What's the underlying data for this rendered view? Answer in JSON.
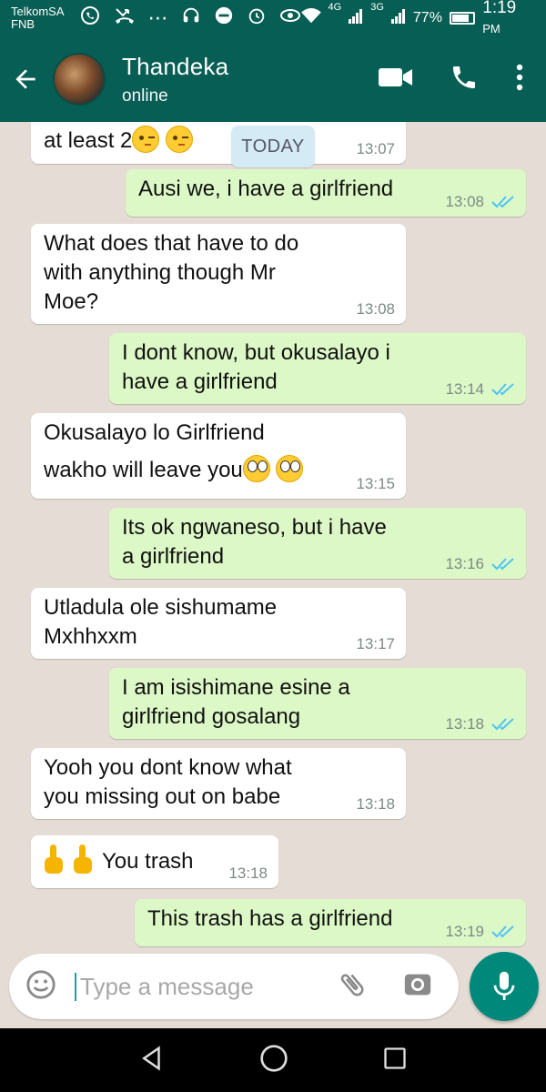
{
  "status_bar": {
    "carrier_line1": "TelkomSA",
    "carrier_line2": "FNB",
    "network_4g": "4G",
    "network_3g": "3G",
    "battery_percent": "77%",
    "battery_level": 0.77,
    "time": "1:19",
    "time_suffix": "PM",
    "icons": [
      "whatsapp-icon",
      "missed-call-icon",
      "more-dots-icon",
      "headset-icon",
      "do-not-disturb-icon",
      "alarm-icon",
      "eye-icon",
      "wifi-icon",
      "signal-icon",
      "battery-icon"
    ]
  },
  "header": {
    "contact_name": "Thandeka",
    "contact_status": "online",
    "icons": [
      "back-arrow-icon",
      "video-call-icon",
      "phone-call-icon",
      "more-vert-icon"
    ]
  },
  "date_pill": "TODAY",
  "messages": [
    {
      "dir": "in",
      "text": "at least 2",
      "emoji": "wink x2",
      "time": "13:07"
    },
    {
      "dir": "out",
      "text": "Ausi we, i have a girlfriend",
      "time": "13:08",
      "status": "read"
    },
    {
      "dir": "in",
      "text": "What does that have to do\nwith anything though Mr\nMoe?",
      "time": "13:08"
    },
    {
      "dir": "out",
      "text": "I dont know, but okusalayo i\nhave a girlfriend",
      "time": "13:14",
      "status": "read"
    },
    {
      "dir": "in",
      "text_line1": "Okusalayo lo Girlfriend",
      "text_line2": "wakho will leave you",
      "emoji": "rolling-eyes x2",
      "time": "13:15"
    },
    {
      "dir": "out",
      "text": "Its ok ngwaneso, but i have\na girlfriend",
      "time": "13:16",
      "status": "read"
    },
    {
      "dir": "in",
      "text": "Utladula ole sishumame\nMxhhxxm",
      "time": "13:17"
    },
    {
      "dir": "out",
      "text": "I am isishimane esine  a\ngirlfriend gosalang",
      "time": "13:18",
      "status": "read"
    },
    {
      "dir": "in",
      "text": "Yooh you dont know what\nyou missing out on babe",
      "time": "13:18"
    },
    {
      "dir": "in",
      "text": "You trash",
      "emoji": "middle-finger x2",
      "time": "13:18"
    },
    {
      "dir": "out",
      "text": "This trash has a girlfriend",
      "time": "13:19",
      "status": "read"
    }
  ],
  "composer": {
    "placeholder": "Type a message",
    "icons": [
      "emoji-icon",
      "attach-icon",
      "camera-icon",
      "mic-icon"
    ]
  },
  "navbar": {
    "icons": [
      "nav-back-icon",
      "nav-home-icon",
      "nav-recents-icon"
    ]
  },
  "colors": {
    "header": "#075e54",
    "chat_bg": "#e5ddd5",
    "out_bubble": "#dcf8c6",
    "in_bubble": "#ffffff",
    "read_ticks": "#4fc3f7",
    "mic_button": "#00897b"
  }
}
